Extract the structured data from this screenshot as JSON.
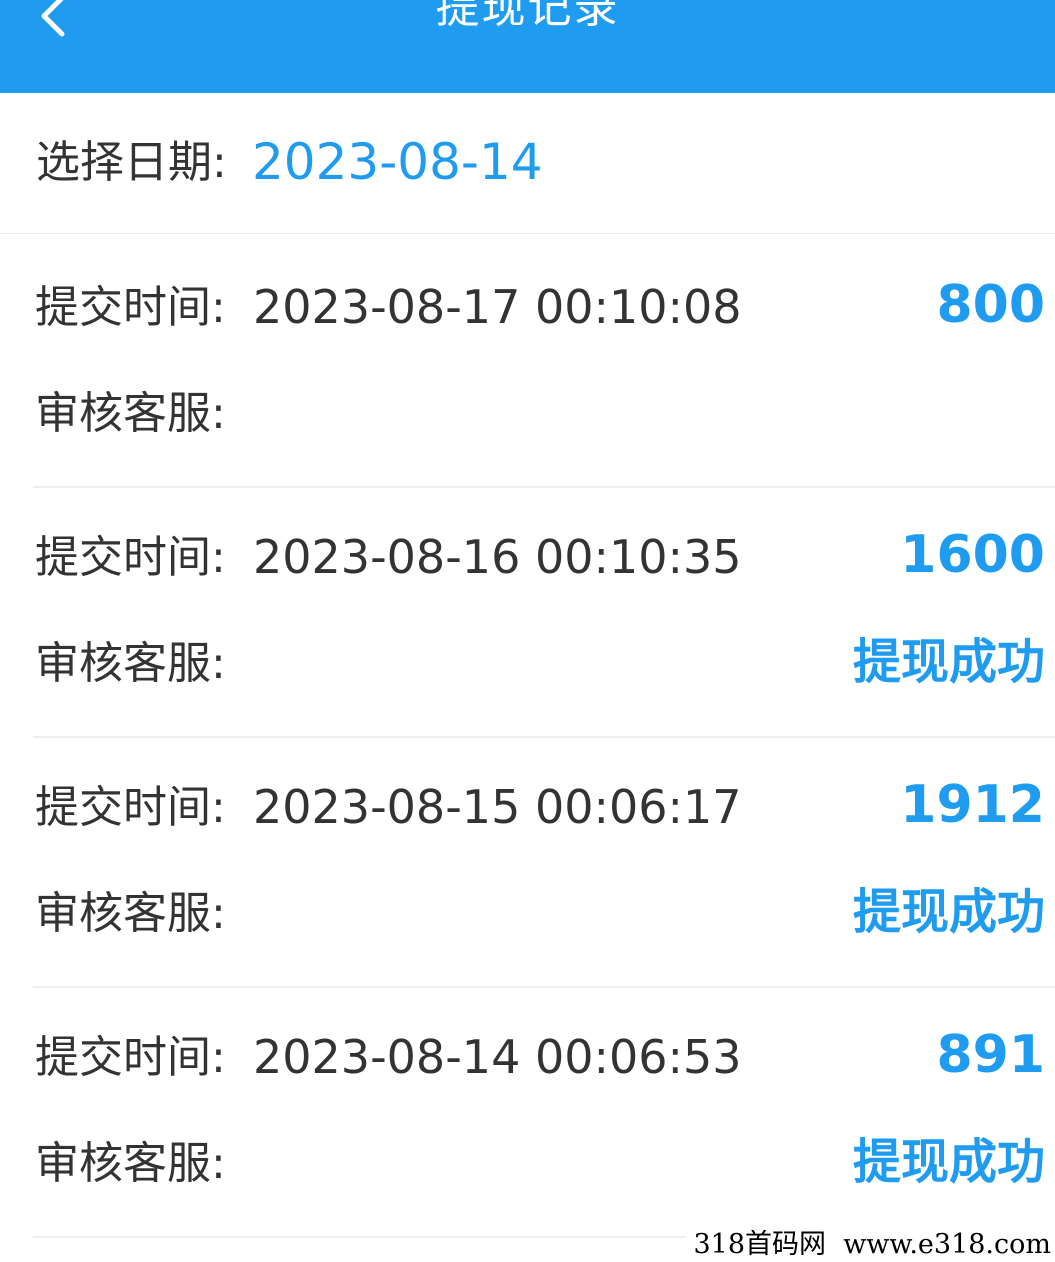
{
  "header": {
    "title": "提现记录",
    "back_icon": "chevron-left-icon",
    "bg_color": "#1f9bef"
  },
  "date_filter": {
    "label": "选择日期:",
    "value": "2023-08-14"
  },
  "records": [
    {
      "time_label": "提交时间:",
      "time": "2023-08-17 00:10:08",
      "amount": "800",
      "reviewer_label": "审核客服:",
      "status": ""
    },
    {
      "time_label": "提交时间:",
      "time": "2023-08-16 00:10:35",
      "amount": "1600",
      "reviewer_label": "审核客服:",
      "status": "提现成功"
    },
    {
      "time_label": "提交时间:",
      "time": "2023-08-15 00:06:17",
      "amount": "1912",
      "reviewer_label": "审核客服:",
      "status": "提现成功"
    },
    {
      "time_label": "提交时间:",
      "time": "2023-08-14 00:06:53",
      "amount": "891",
      "reviewer_label": "审核客服:",
      "status": "提现成功"
    }
  ],
  "watermark": {
    "text": "318首码网  www.e318.com"
  },
  "colors": {
    "accent": "#1f9bef",
    "text": "#333333"
  }
}
